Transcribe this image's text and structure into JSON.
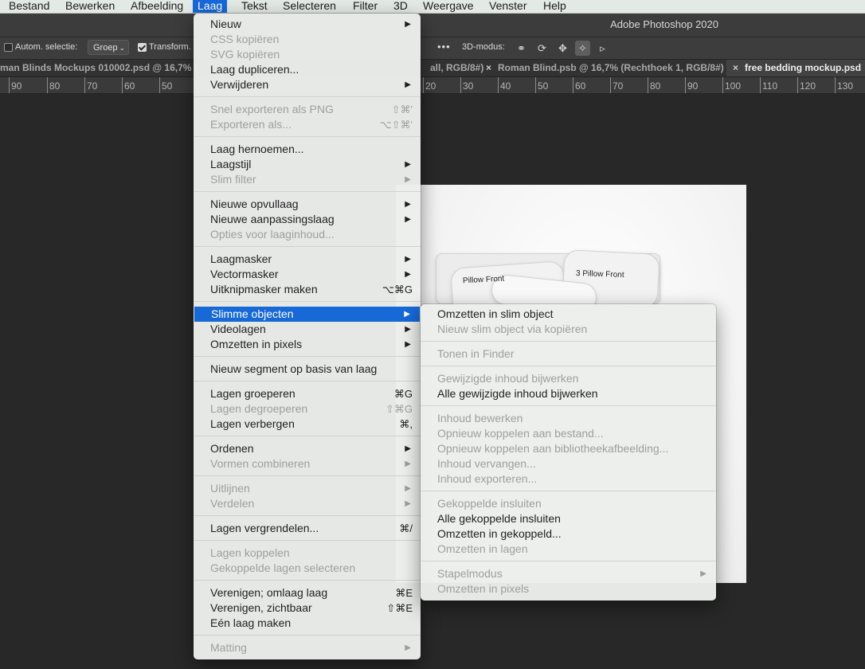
{
  "menubar": {
    "items": [
      "Bestand",
      "Bewerken",
      "Afbeelding",
      "Laag",
      "Tekst",
      "Selecteren",
      "Filter",
      "3D",
      "Weergave",
      "Venster",
      "Help"
    ],
    "active": "Laag"
  },
  "window": {
    "title": "Adobe Photoshop 2020"
  },
  "options": {
    "auto_select_label": "Autom. selectie:",
    "auto_select_checked": false,
    "auto_select_target": "Groep",
    "transform_label": "Transform.",
    "transform_checked": true,
    "more": "•••",
    "mode_3d_label": "3D-modus:"
  },
  "tabs": [
    {
      "label": "man Blinds Mockups 010002.psd @ 16,7% (",
      "active": false
    },
    {
      "label": "all, RGB/8#)",
      "active": false
    },
    {
      "label": "Roman Blind.psb @ 16,7% (Rechthoek 1, RGB/8#)",
      "active": false
    },
    {
      "label": "free bedding mockup.psd",
      "active": true
    }
  ],
  "ruler": {
    "labels": [
      "90",
      "80",
      "70",
      "60",
      "50",
      "20",
      "30",
      "40",
      "50",
      "60",
      "70",
      "80",
      "90",
      "100",
      "110",
      "120",
      "130"
    ]
  },
  "canvas": {
    "pillow_labels": [
      "Pillow Front",
      "3 Pillow Front"
    ]
  },
  "layer_menu": {
    "groups": [
      [
        {
          "label": "Nieuw",
          "enabled": true,
          "submenu": true
        },
        {
          "label": "CSS kopiëren",
          "enabled": false
        },
        {
          "label": "SVG kopiëren",
          "enabled": false
        },
        {
          "label": "Laag dupliceren...",
          "enabled": true
        },
        {
          "label": "Verwijderen",
          "enabled": true,
          "submenu": true
        }
      ],
      [
        {
          "label": "Snel exporteren als PNG",
          "enabled": false,
          "shortcut": "⇧⌘'"
        },
        {
          "label": "Exporteren als...",
          "enabled": false,
          "shortcut": "⌥⇧⌘'"
        }
      ],
      [
        {
          "label": "Laag hernoemen...",
          "enabled": true
        },
        {
          "label": "Laagstijl",
          "enabled": true,
          "submenu": true
        },
        {
          "label": "Slim filter",
          "enabled": false,
          "submenu": true
        }
      ],
      [
        {
          "label": "Nieuwe opvullaag",
          "enabled": true,
          "submenu": true
        },
        {
          "label": "Nieuwe aanpassingslaag",
          "enabled": true,
          "submenu": true
        },
        {
          "label": "Opties voor laaginhoud...",
          "enabled": false
        }
      ],
      [
        {
          "label": "Laagmasker",
          "enabled": true,
          "submenu": true
        },
        {
          "label": "Vectormasker",
          "enabled": true,
          "submenu": true
        },
        {
          "label": "Uitknipmasker maken",
          "enabled": true,
          "shortcut": "⌥⌘G"
        }
      ],
      [
        {
          "label": "Slimme objecten",
          "enabled": true,
          "submenu": true,
          "highlighted": true
        },
        {
          "label": "Videolagen",
          "enabled": true,
          "submenu": true
        },
        {
          "label": "Omzetten in pixels",
          "enabled": true,
          "submenu": true
        }
      ],
      [
        {
          "label": "Nieuw segment op basis van laag",
          "enabled": true
        }
      ],
      [
        {
          "label": "Lagen groeperen",
          "enabled": true,
          "shortcut": "⌘G"
        },
        {
          "label": "Lagen degroeperen",
          "enabled": false,
          "shortcut": "⇧⌘G"
        },
        {
          "label": "Lagen verbergen",
          "enabled": true,
          "shortcut": "⌘,"
        }
      ],
      [
        {
          "label": "Ordenen",
          "enabled": true,
          "submenu": true
        },
        {
          "label": "Vormen combineren",
          "enabled": false,
          "submenu": true
        }
      ],
      [
        {
          "label": "Uitlijnen",
          "enabled": false,
          "submenu": true
        },
        {
          "label": "Verdelen",
          "enabled": false,
          "submenu": true
        }
      ],
      [
        {
          "label": "Lagen vergrendelen...",
          "enabled": true,
          "shortcut": "⌘/"
        }
      ],
      [
        {
          "label": "Lagen koppelen",
          "enabled": false
        },
        {
          "label": "Gekoppelde lagen selecteren",
          "enabled": false
        }
      ],
      [
        {
          "label": "Verenigen; omlaag laag",
          "enabled": true,
          "shortcut": "⌘E"
        },
        {
          "label": "Verenigen, zichtbaar",
          "enabled": true,
          "shortcut": "⇧⌘E"
        },
        {
          "label": "Eén laag maken",
          "enabled": true
        }
      ],
      [
        {
          "label": "Matting",
          "enabled": false,
          "submenu": true
        }
      ]
    ]
  },
  "smart_objects_menu": {
    "groups": [
      [
        {
          "label": "Omzetten in slim object",
          "enabled": true
        },
        {
          "label": "Nieuw slim object via kopiëren",
          "enabled": false
        }
      ],
      [
        {
          "label": "Tonen in Finder",
          "enabled": false
        }
      ],
      [
        {
          "label": "Gewijzigde inhoud bijwerken",
          "enabled": false
        },
        {
          "label": "Alle gewijzigde inhoud bijwerken",
          "enabled": true
        }
      ],
      [
        {
          "label": "Inhoud bewerken",
          "enabled": false
        },
        {
          "label": "Opnieuw koppelen aan bestand...",
          "enabled": false
        },
        {
          "label": "Opnieuw koppelen aan bibliotheekafbeelding...",
          "enabled": false
        },
        {
          "label": "Inhoud vervangen...",
          "enabled": false
        },
        {
          "label": "Inhoud exporteren...",
          "enabled": false
        }
      ],
      [
        {
          "label": "Gekoppelde insluiten",
          "enabled": false
        },
        {
          "label": "Alle gekoppelde insluiten",
          "enabled": true
        },
        {
          "label": "Omzetten in gekoppeld...",
          "enabled": true
        },
        {
          "label": "Omzetten in lagen",
          "enabled": false
        }
      ],
      [
        {
          "label": "Stapelmodus",
          "enabled": false,
          "submenu": true
        },
        {
          "label": "Omzetten in pixels",
          "enabled": false
        }
      ]
    ]
  },
  "colors": {
    "accent": "#1769d8",
    "menu_bg": "#eceeec",
    "disabled": "#9d9f9d",
    "canvas_bg": "#282828"
  }
}
